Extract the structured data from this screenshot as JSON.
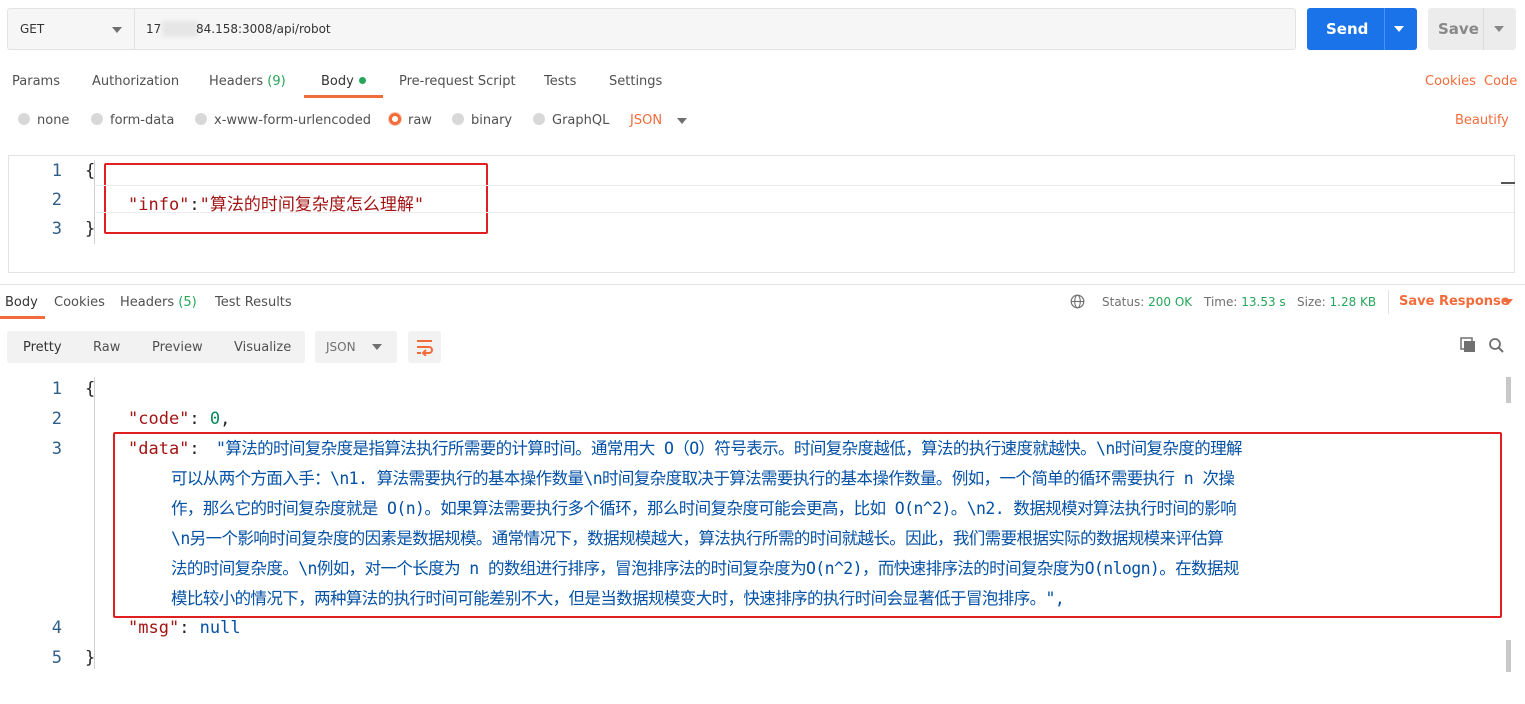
{
  "request": {
    "method": "GET",
    "url_prefix": "17",
    "url_suffix": "84.158:3008/api/robot",
    "send_label": "Send",
    "save_label": "Save"
  },
  "tabs": [
    {
      "label": "Params"
    },
    {
      "label": "Authorization"
    },
    {
      "label": "Headers",
      "count": "(9)"
    },
    {
      "label": "Body"
    },
    {
      "label": "Pre-request Script"
    },
    {
      "label": "Tests"
    },
    {
      "label": "Settings"
    }
  ],
  "links": {
    "cookies": "Cookies",
    "code": "Code",
    "beautify": "Beautify"
  },
  "body_types": [
    {
      "label": "none",
      "selected": false
    },
    {
      "label": "form-data",
      "selected": false
    },
    {
      "label": "x-www-form-urlencoded",
      "selected": false
    },
    {
      "label": "raw",
      "selected": true
    },
    {
      "label": "binary",
      "selected": false
    },
    {
      "label": "GraphQL",
      "selected": false
    }
  ],
  "raw_format": "JSON",
  "request_body": {
    "line_numbers": [
      "1",
      "2",
      "3"
    ],
    "open": "{",
    "key": "\"info\"",
    "colon": ":",
    "value": "\"算法的时间复杂度怎么理解\"",
    "close": "}"
  },
  "response": {
    "tabs": [
      {
        "label": "Body"
      },
      {
        "label": "Cookies"
      },
      {
        "label": "Headers",
        "count": "(5)"
      },
      {
        "label": "Test Results"
      }
    ],
    "status_label": "Status:",
    "status_value": "200 OK",
    "time_label": "Time:",
    "time_value": "13.53 s",
    "size_label": "Size:",
    "size_value": "1.28 KB",
    "save_response": "Save Response",
    "view_modes": [
      "Pretty",
      "Raw",
      "Preview",
      "Visualize"
    ],
    "format": "JSON",
    "line_numbers": [
      "1",
      "2",
      "3",
      "4",
      "5"
    ],
    "open": "{",
    "code_key": "\"code\"",
    "code_value": "0",
    "data_key": "\"data\"",
    "data_lines": [
      "\"算法的时间复杂度是指算法执行所需要的计算时间。通常用大 O（O）符号表示。时间复杂度越低，算法的执行速度就越快。\\n时间复杂度的理解",
      "可以从两个方面入手：\\n1. 算法需要执行的基本操作数量\\n时间复杂度取决于算法需要执行的基本操作数量。例如，一个简单的循环需要执行 n 次操",
      "作，那么它的时间复杂度就是 O(n)。如果算法需要执行多个循环，那么时间复杂度可能会更高，比如 O(n^2)。\\n2. 数据规模对算法执行时间的影响",
      "\\n另一个影响时间复杂度的因素是数据规模。通常情况下，数据规模越大，算法执行所需的时间就越长。因此，我们需要根据实际的数据规模来评估算",
      "法的时间复杂度。\\n例如，对一个长度为 n 的数组进行排序，冒泡排序法的时间复杂度为O(n^2)，而快速排序法的时间复杂度为O(nlogn)。在数据规",
      "模比较小的情况下，两种算法的执行时间可能差别不大，但是当数据规模变大时，快速排序的执行时间会显著低于冒泡排序。\","
    ],
    "msg_key": "\"msg\"",
    "msg_value": "null",
    "close": "}"
  },
  "colors": {
    "accent": "#f26b3a",
    "send": "#1a73e8",
    "success": "#26a659",
    "highlight_box": "#e02020"
  }
}
